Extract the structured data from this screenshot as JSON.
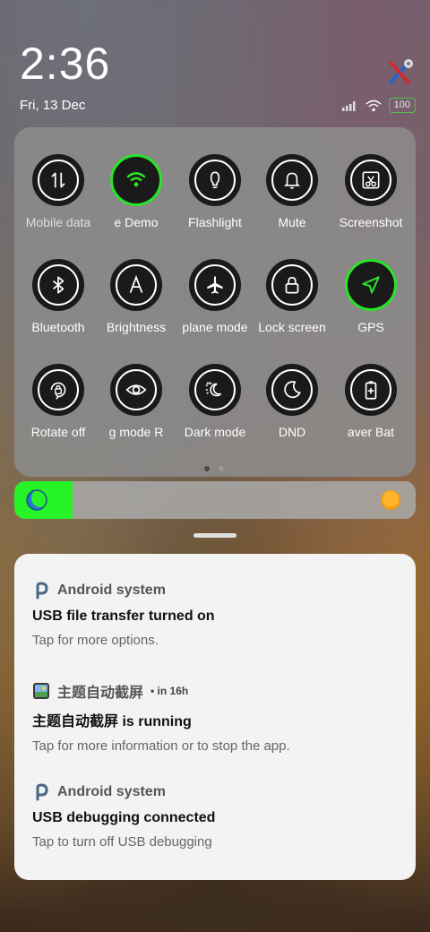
{
  "status": {
    "time": "2:36",
    "date": "Fri, 13 Dec",
    "battery": "100"
  },
  "quick_settings": {
    "tiles": [
      {
        "label": "Mobile data",
        "icon": "mobile-data-icon",
        "active": false,
        "dim": true
      },
      {
        "label": "e   Demo",
        "icon": "wifi-icon",
        "active": true,
        "dim": false
      },
      {
        "label": "Flashlight",
        "icon": "flashlight-icon",
        "active": false,
        "dim": false
      },
      {
        "label": "Mute",
        "icon": "bell-icon",
        "active": false,
        "dim": false
      },
      {
        "label": "Screenshot",
        "icon": "screenshot-icon",
        "active": false,
        "dim": false
      },
      {
        "label": "Bluetooth",
        "icon": "bluetooth-icon",
        "active": false,
        "dim": false
      },
      {
        "label": "Brightness",
        "icon": "auto-brightness-icon",
        "active": false,
        "dim": false
      },
      {
        "label": "plane mode",
        "icon": "airplane-icon",
        "active": false,
        "dim": false
      },
      {
        "label": "Lock screen",
        "icon": "lock-icon",
        "active": false,
        "dim": false
      },
      {
        "label": "GPS",
        "icon": "location-arrow-icon",
        "active": true,
        "dim": false
      },
      {
        "label": "Rotate off",
        "icon": "rotate-lock-icon",
        "active": false,
        "dim": false
      },
      {
        "label": "g mode    R",
        "icon": "eye-icon",
        "active": false,
        "dim": false
      },
      {
        "label": "Dark mode",
        "icon": "dark-mode-icon",
        "active": false,
        "dim": false
      },
      {
        "label": "DND",
        "icon": "moon-icon",
        "active": false,
        "dim": false
      },
      {
        "label": "aver    Bat",
        "icon": "battery-saver-icon",
        "active": false,
        "dim": false
      }
    ],
    "page_count": 2,
    "current_page": 1
  },
  "brightness": {
    "level": 0.145,
    "fill_color": "#27f427"
  },
  "notifications": [
    {
      "app": "Android system",
      "meta": "",
      "title": "USB file transfer turned on",
      "body": "Tap for more options.",
      "icon": "android-p-icon"
    },
    {
      "app": "主题自动截屏",
      "meta": "• in 16h",
      "title": "主题自动截屏 is running",
      "body": "Tap for more information or to stop the app.",
      "icon": "app-screenshot-icon"
    },
    {
      "app": "Android system",
      "meta": "",
      "title": "USB debugging connected",
      "body": "Tap to turn off USB debugging",
      "icon": "android-p-icon"
    }
  ]
}
